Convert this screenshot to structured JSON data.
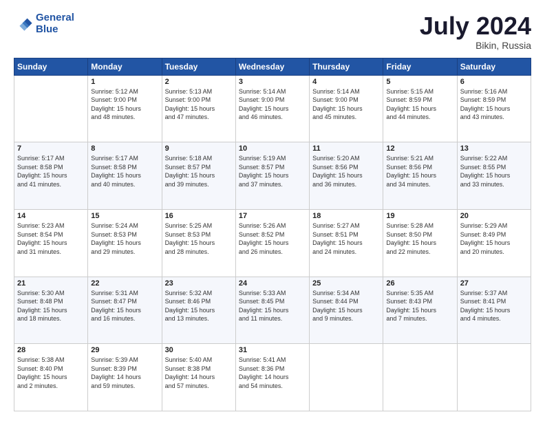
{
  "header": {
    "logo_line1": "General",
    "logo_line2": "Blue",
    "title": "July 2024",
    "subtitle": "Bikin, Russia"
  },
  "days_of_week": [
    "Sunday",
    "Monday",
    "Tuesday",
    "Wednesday",
    "Thursday",
    "Friday",
    "Saturday"
  ],
  "weeks": [
    [
      {
        "day": "",
        "info": ""
      },
      {
        "day": "1",
        "info": "Sunrise: 5:12 AM\nSunset: 9:00 PM\nDaylight: 15 hours\nand 48 minutes."
      },
      {
        "day": "2",
        "info": "Sunrise: 5:13 AM\nSunset: 9:00 PM\nDaylight: 15 hours\nand 47 minutes."
      },
      {
        "day": "3",
        "info": "Sunrise: 5:14 AM\nSunset: 9:00 PM\nDaylight: 15 hours\nand 46 minutes."
      },
      {
        "day": "4",
        "info": "Sunrise: 5:14 AM\nSunset: 9:00 PM\nDaylight: 15 hours\nand 45 minutes."
      },
      {
        "day": "5",
        "info": "Sunrise: 5:15 AM\nSunset: 8:59 PM\nDaylight: 15 hours\nand 44 minutes."
      },
      {
        "day": "6",
        "info": "Sunrise: 5:16 AM\nSunset: 8:59 PM\nDaylight: 15 hours\nand 43 minutes."
      }
    ],
    [
      {
        "day": "7",
        "info": "Sunrise: 5:17 AM\nSunset: 8:58 PM\nDaylight: 15 hours\nand 41 minutes."
      },
      {
        "day": "8",
        "info": "Sunrise: 5:17 AM\nSunset: 8:58 PM\nDaylight: 15 hours\nand 40 minutes."
      },
      {
        "day": "9",
        "info": "Sunrise: 5:18 AM\nSunset: 8:57 PM\nDaylight: 15 hours\nand 39 minutes."
      },
      {
        "day": "10",
        "info": "Sunrise: 5:19 AM\nSunset: 8:57 PM\nDaylight: 15 hours\nand 37 minutes."
      },
      {
        "day": "11",
        "info": "Sunrise: 5:20 AM\nSunset: 8:56 PM\nDaylight: 15 hours\nand 36 minutes."
      },
      {
        "day": "12",
        "info": "Sunrise: 5:21 AM\nSunset: 8:56 PM\nDaylight: 15 hours\nand 34 minutes."
      },
      {
        "day": "13",
        "info": "Sunrise: 5:22 AM\nSunset: 8:55 PM\nDaylight: 15 hours\nand 33 minutes."
      }
    ],
    [
      {
        "day": "14",
        "info": "Sunrise: 5:23 AM\nSunset: 8:54 PM\nDaylight: 15 hours\nand 31 minutes."
      },
      {
        "day": "15",
        "info": "Sunrise: 5:24 AM\nSunset: 8:53 PM\nDaylight: 15 hours\nand 29 minutes."
      },
      {
        "day": "16",
        "info": "Sunrise: 5:25 AM\nSunset: 8:53 PM\nDaylight: 15 hours\nand 28 minutes."
      },
      {
        "day": "17",
        "info": "Sunrise: 5:26 AM\nSunset: 8:52 PM\nDaylight: 15 hours\nand 26 minutes."
      },
      {
        "day": "18",
        "info": "Sunrise: 5:27 AM\nSunset: 8:51 PM\nDaylight: 15 hours\nand 24 minutes."
      },
      {
        "day": "19",
        "info": "Sunrise: 5:28 AM\nSunset: 8:50 PM\nDaylight: 15 hours\nand 22 minutes."
      },
      {
        "day": "20",
        "info": "Sunrise: 5:29 AM\nSunset: 8:49 PM\nDaylight: 15 hours\nand 20 minutes."
      }
    ],
    [
      {
        "day": "21",
        "info": "Sunrise: 5:30 AM\nSunset: 8:48 PM\nDaylight: 15 hours\nand 18 minutes."
      },
      {
        "day": "22",
        "info": "Sunrise: 5:31 AM\nSunset: 8:47 PM\nDaylight: 15 hours\nand 16 minutes."
      },
      {
        "day": "23",
        "info": "Sunrise: 5:32 AM\nSunset: 8:46 PM\nDaylight: 15 hours\nand 13 minutes."
      },
      {
        "day": "24",
        "info": "Sunrise: 5:33 AM\nSunset: 8:45 PM\nDaylight: 15 hours\nand 11 minutes."
      },
      {
        "day": "25",
        "info": "Sunrise: 5:34 AM\nSunset: 8:44 PM\nDaylight: 15 hours\nand 9 minutes."
      },
      {
        "day": "26",
        "info": "Sunrise: 5:35 AM\nSunset: 8:43 PM\nDaylight: 15 hours\nand 7 minutes."
      },
      {
        "day": "27",
        "info": "Sunrise: 5:37 AM\nSunset: 8:41 PM\nDaylight: 15 hours\nand 4 minutes."
      }
    ],
    [
      {
        "day": "28",
        "info": "Sunrise: 5:38 AM\nSunset: 8:40 PM\nDaylight: 15 hours\nand 2 minutes."
      },
      {
        "day": "29",
        "info": "Sunrise: 5:39 AM\nSunset: 8:39 PM\nDaylight: 14 hours\nand 59 minutes."
      },
      {
        "day": "30",
        "info": "Sunrise: 5:40 AM\nSunset: 8:38 PM\nDaylight: 14 hours\nand 57 minutes."
      },
      {
        "day": "31",
        "info": "Sunrise: 5:41 AM\nSunset: 8:36 PM\nDaylight: 14 hours\nand 54 minutes."
      },
      {
        "day": "",
        "info": ""
      },
      {
        "day": "",
        "info": ""
      },
      {
        "day": "",
        "info": ""
      }
    ]
  ]
}
